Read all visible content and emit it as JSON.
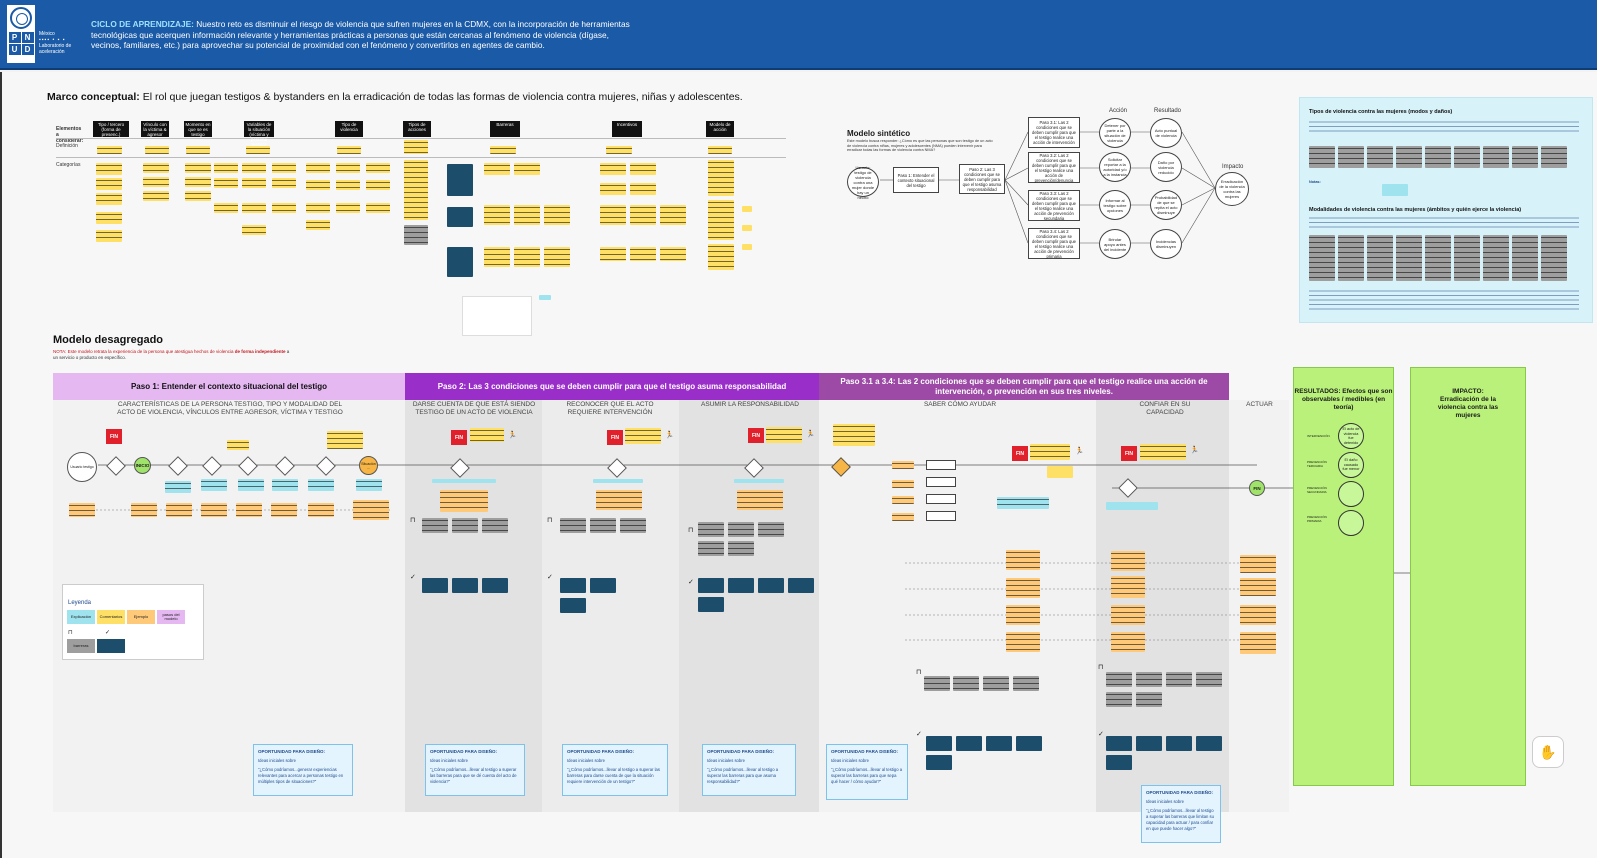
{
  "header": {
    "org_lines": [
      "PNUD",
      "México",
      "Laboratorio de aceleración"
    ],
    "bold_label": "CICLO DE APRENDIZAJE:",
    "text": " Nuestro reto es disminuir el riesgo de violencia que sufren mujeres en la CDMX, con la incorporación de herramientas tecnológicas que acerquen información relevante y herramientas prácticas a personas que están cercanas al fenómeno de violencia (dígase, vecinos, familiares, etc.) para aprovechar su potencial de proximidad con el fenómeno y convertirlos en agentes de cambio."
  },
  "marco": {
    "bold": "Marco conceptual:",
    "rest": " El rol que juegan testigos & bystanders en la erradicación de todas las formas de violencia contra mujeres, niñas y adolescentes.",
    "row_labels": [
      "Elementos a considerar:",
      "Definición",
      "Categorías"
    ],
    "columns": [
      "Tipo / tercero (forma de presenc.)",
      "Vínculo con la víctima & agresor",
      "Momento en que se es testigo",
      "Variables de la situación (víctima y persona testigo)",
      "Tipo de violencia",
      "Tipos de acciones",
      "Barreras",
      "Incentivos",
      "Modelo de acción"
    ]
  },
  "sintetico": {
    "title": "Modelo sintético",
    "desc": "Este modelo busca responder: ¿Cómo es que las personas que son testigo de un acto de violencia contra niñas, mujeres y adolescentes (NMA) pueden intervenir para erradicar todas las formas de violencia contra NMA?",
    "col_accion": "Acción",
    "col_resultado": "Resultado",
    "col_impacto": "Impacto",
    "start": "Usuario: testigo de violencia contra una mujer donde hay un hecho",
    "paso1": "Paso 1: Entender el contexto situacional del testigo",
    "paso2": "Paso 2: Las 3 condiciones que se deben cumplir para que el testigo asuma responsabilidad",
    "pasos3": [
      "Paso 3.1: Las 2 condiciones que se deben cumplir para que el testigo realice una acción de intervención",
      "Paso 3.2: Las 2 condiciones que se deben cumplir para que el testigo realice una acción de prevención/denuncia",
      "Paso 3.3: Las 2 condiciones que se deben cumplir para que el testigo realice una acción de prevención secundaria",
      "Paso 3.4: Las 2 condiciones que se deben cumplir para que el testigo realice una acción de prevención primaria"
    ],
    "acciones": [
      "Detener por parte a la situación de violencia",
      "Solicitar reportar a la autoridad y/o a la instancia",
      "Informar al testigo sobre opciones",
      "Brindar apoyo antes del incidente"
    ],
    "resultados": [
      "Acto puntual de violencia",
      "Daño por violencia reducido",
      "Probabilidad de que se repita el acto disminuye",
      "Incidencias disminuyen"
    ],
    "impacto": "Erradicación de la violencia contra las mujeres"
  },
  "info": {
    "title1": "Tipos de violencia contra las mujeres (modos y daños)",
    "title2": "Modalidades de violencia contra las mujeres (ámbitos y quién ejerce la violencia)",
    "nota": "Notas:"
  },
  "desagregado": {
    "title": "Modelo desagregado",
    "nota_prefix": "NOTA: Este modelo retrata la experiencia de la persona que atestigua hechos de violencia ",
    "nota_red": "de forma independiente",
    "nota_suffix": " a un servicio o producto en específico."
  },
  "phases": [
    {
      "label": "Paso 1: Entender el contexto situacional del testigo",
      "color": "#e5b8f2"
    },
    {
      "label": "Paso 2: Las 3 condiciones que se deben cumplir para que el testigo asuma responsabilidad",
      "color": "#9a2ec9"
    },
    {
      "label": "Paso 3.1 a 3.4: Las 2 condiciones que se deben cumplir para que el testigo realice una acción de intervención, o prevención en sus tres niveles.",
      "color": "#9c4aa6"
    }
  ],
  "lanes": [
    "CARACTERÍSTICAS DE LA PERSONA TESTIGO, TIPO Y MODALIDAD DEL ACTO DE VIOLENCIA, VÍNCULOS ENTRE AGRESOR, VÍCTIMA Y TESTIGO",
    "DARSE CUENTA DE QUE ESTÁ SIENDO TESTIGO DE UN ACTO DE VIOLENCIA",
    "RECONOCER QUE EL ACTO REQUIERE INTERVENCIÓN",
    "ASUMIR LA RESPONSABILIDAD",
    "SABER CÓMO AYUDAR",
    "CONFIAR EN SU CAPACIDAD",
    "ACTUAR"
  ],
  "flow": {
    "fin": "FIN",
    "inicio": "INICIO",
    "situacion": "Situación ...",
    "si": "Sí",
    "no": "No"
  },
  "opportunities": [
    {
      "title": "OPORTUNIDAD PARA DISEÑO:",
      "sub": "Ideas iniciales sobre",
      "q": "\"¿Cómo podríamos...generar experiencias relevantes para acercar a personas testigo en múltiples tipos de situaciones?\""
    },
    {
      "title": "OPORTUNIDAD PARA DISEÑO:",
      "sub": "Ideas iniciales sobre",
      "q": "\"¿Cómo podríamos...llevar al testigo a superar las barreras para que se dé cuenta del acto de violencia?\""
    },
    {
      "title": "OPORTUNIDAD PARA DISEÑO:",
      "sub": "Ideas iniciales sobre",
      "q": "\"¿Cómo podríamos...llevar al testigo a superar las barreras para darse cuenta de que la situación requiere intervención de un testigo?\""
    },
    {
      "title": "OPORTUNIDAD PARA DISEÑO:",
      "sub": "Ideas iniciales sobre",
      "q": "\"¿Cómo podríamos...llevar al testigo a superar las barreras para que asuma responsabilidad?\""
    },
    {
      "title": "OPORTUNIDAD PARA DISEÑO:",
      "sub": "Ideas iniciales sobre",
      "q": "\"¿Cómo podríamos...llevar al testigo a superar las barreras para que sepa qué hacer / cómo ayudar?\""
    },
    {
      "title": "OPORTUNIDAD PARA DISEÑO:",
      "sub": "Ideas iniciales sobre",
      "q": "\"¿Cómo podríamos...llevar al testigo a superar las barreras que limitan su capacidad para actuar / para confiar en que puede hacer algo?\""
    }
  ],
  "resultados": {
    "title": "RESULTADOS: Efectos que son observables / medibles (en teoría)",
    "circles": [
      "El acto de violencia fue detenido",
      "El daño causado fue menor",
      "",
      ""
    ],
    "labels": [
      "INTERVENCIÓN",
      "PREVENCIÓN TERCIARIA",
      "PREVENCIÓN SECUNDARIA",
      "PREVENCIÓN PRIMARIA"
    ]
  },
  "impacto": {
    "title": "IMPACTO: Erradicación de la violencia contra las mujeres"
  },
  "legend": {
    "title": "Leyenda",
    "items": [
      "Explicación",
      "Comentarios",
      "Ejemplo",
      "pasos del modelo",
      "barreras",
      ""
    ]
  },
  "colors": {
    "header": "#1a5aa6",
    "yellow": "#ffe066",
    "orange": "#ffc97a",
    "cyan": "#9fe3ef",
    "navy": "#1c4e6b",
    "green": "#b9f17a",
    "red": "#e0202a"
  },
  "icons": [
    "un-emblem-icon",
    "hand-icon",
    "runner-icon",
    "barrier-icon",
    "check-icon"
  ]
}
